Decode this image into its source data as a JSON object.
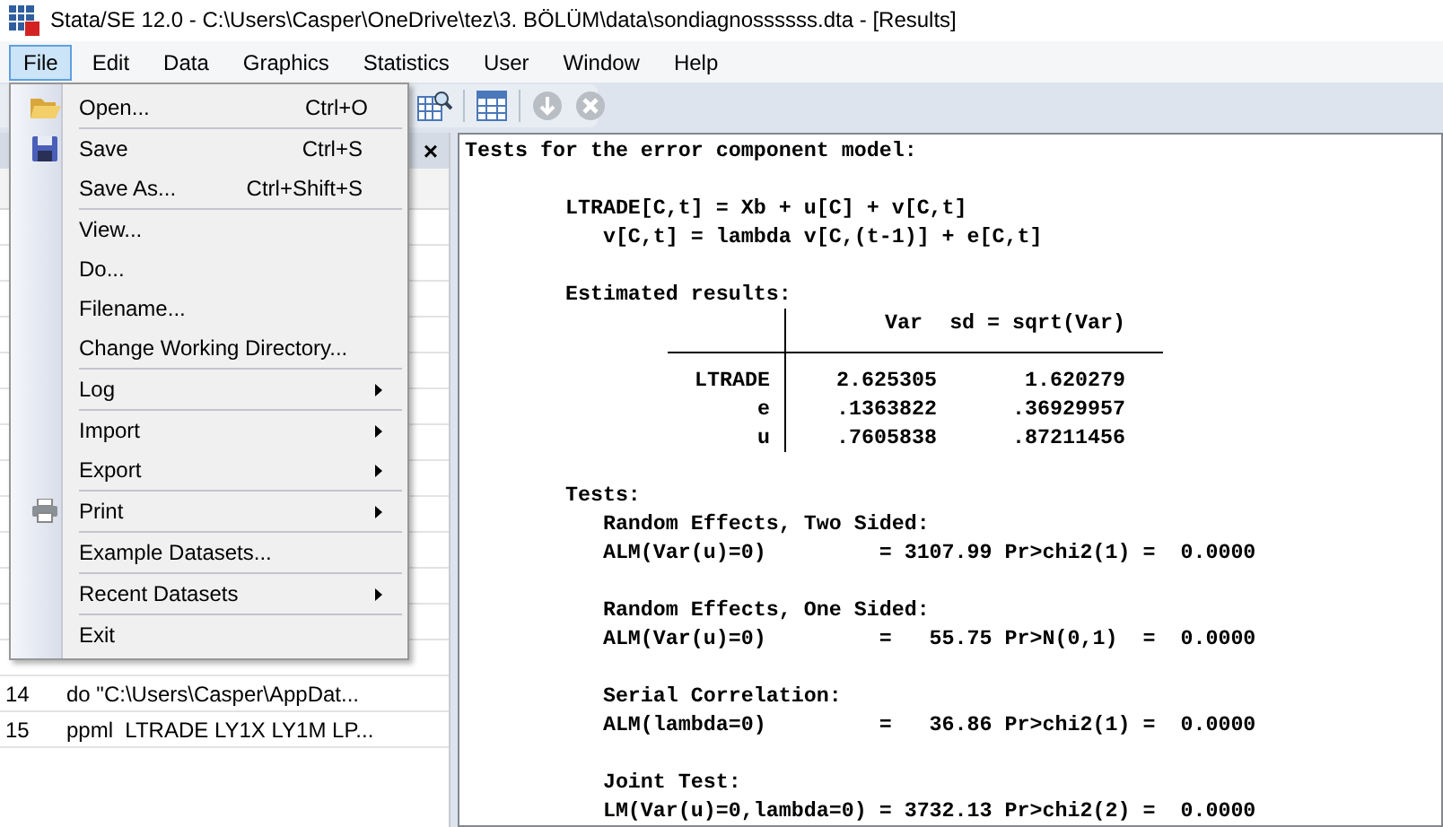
{
  "window": {
    "title": "Stata/SE 12.0 - C:\\Users\\Casper\\OneDrive\\tez\\3. BÖLÜM\\data\\sondiagnossssss.dta - [Results]"
  },
  "menu_bar": [
    {
      "label": "File",
      "selected": true
    },
    {
      "label": "Edit",
      "selected": false
    },
    {
      "label": "Data",
      "selected": false
    },
    {
      "label": "Graphics",
      "selected": false
    },
    {
      "label": "Statistics",
      "selected": false
    },
    {
      "label": "User",
      "selected": false
    },
    {
      "label": "Window",
      "selected": false
    },
    {
      "label": "Help",
      "selected": false
    }
  ],
  "file_menu": {
    "groups": [
      [
        {
          "label": "Open...",
          "shortcut": "Ctrl+O",
          "kind": "command"
        }
      ],
      [
        {
          "label": "Save",
          "shortcut": "Ctrl+S",
          "kind": "command"
        },
        {
          "label": "Save As...",
          "shortcut": "Ctrl+Shift+S",
          "kind": "command"
        }
      ],
      [
        {
          "label": "View...",
          "kind": "command"
        },
        {
          "label": "Do...",
          "kind": "command"
        },
        {
          "label": "Filename...",
          "kind": "command"
        },
        {
          "label": "Change Working Directory...",
          "kind": "command"
        }
      ],
      [
        {
          "label": "Log",
          "kind": "submenu"
        }
      ],
      [
        {
          "label": "Import",
          "kind": "submenu"
        },
        {
          "label": "Export",
          "kind": "submenu"
        }
      ],
      [
        {
          "label": "Print",
          "kind": "submenu"
        }
      ],
      [
        {
          "label": "Example Datasets...",
          "kind": "command"
        }
      ],
      [
        {
          "label": "Recent Datasets",
          "kind": "submenu"
        }
      ],
      [
        {
          "label": "Exit",
          "kind": "command"
        }
      ]
    ]
  },
  "history": {
    "close": "×",
    "rows": [
      {
        "number": "14",
        "command": "do \"C:\\Users\\Casper\\AppDat..."
      },
      {
        "number": "15",
        "command": "ppml  LTRADE LY1X LY1M LP..."
      }
    ]
  },
  "results": {
    "blocks": [
      {
        "kind": "text",
        "lines": [
          "Tests for the error component model:"
        ]
      },
      {
        "kind": "text",
        "lines": [
          "        LTRADE[C,t] = Xb + u[C] + v[C,t]",
          "           v[C,t] = lambda v[C,(t-1)] + e[C,t]"
        ]
      },
      {
        "kind": "table",
        "caption": "        Estimated results:",
        "columns": [
          "",
          "Var",
          "sd = sqrt(Var)"
        ],
        "rows": [
          [
            "LTRADE",
            "2.625305",
            "1.620279"
          ],
          [
            "e",
            ".1363822",
            ".36929957"
          ],
          [
            "u",
            ".7605838",
            ".87211456"
          ]
        ]
      },
      {
        "kind": "text",
        "lines": [
          "        Tests:",
          "           Random Effects, Two Sided:",
          "           ALM(Var(u)=0)         = 3107.99 Pr>chi2(1) =  0.0000"
        ]
      },
      {
        "kind": "text",
        "lines": [
          "           Random Effects, One Sided:",
          "           ALM(Var(u)=0)         =   55.75 Pr>N(0,1)  =  0.0000"
        ]
      },
      {
        "kind": "text",
        "lines": [
          "           Serial Correlation:",
          "           ALM(lambda=0)         =   36.86 Pr>chi2(1) =  0.0000"
        ]
      },
      {
        "kind": "text",
        "lines": [
          "           Joint Test:",
          "           LM(Var(u)=0,lambda=0) = 3732.13 Pr>chi2(2) =  0.0000"
        ]
      }
    ]
  }
}
